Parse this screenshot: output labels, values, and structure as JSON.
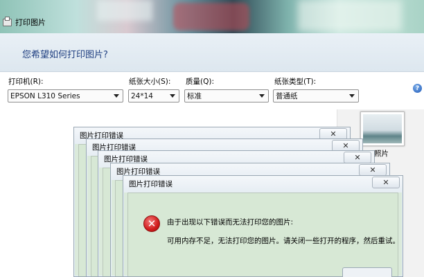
{
  "window": {
    "title": "打印图片",
    "icon": "printer-icon"
  },
  "header": {
    "question": "您希望如何打印图片?"
  },
  "fields": {
    "printer": {
      "label": "打印机(R):",
      "value": "EPSON L310 Series"
    },
    "paper_size": {
      "label": "纸张大小(S):",
      "value": "24*14"
    },
    "quality": {
      "label": "质量(Q):",
      "value": "标准"
    },
    "paper_type": {
      "label": "纸张类型(T):",
      "value": "普通纸"
    }
  },
  "help": {
    "icon": "help-icon",
    "glyph": "?"
  },
  "thumbnail": {
    "label": "照片"
  },
  "error_windows": [
    {
      "caption": "图片打印错误",
      "close": "✕"
    },
    {
      "caption": "图片打印错误",
      "close": "✕"
    },
    {
      "caption": "图片打印错误",
      "close": "✕"
    },
    {
      "caption": "图片打印错误",
      "close": "✕"
    },
    {
      "caption": "图片打印错误",
      "close": "✕"
    }
  ],
  "error": {
    "icon": "error-icon",
    "title": "由于出现以下错误而无法打印您的图片:",
    "message": "可用内存不足，无法打印您的图片。请关闭一些打开的程序，然后重试。"
  },
  "colors": {
    "dialog_green": "#d7e8d5",
    "header_blue": "#1e3e80",
    "error_red": "#d11c1c"
  }
}
